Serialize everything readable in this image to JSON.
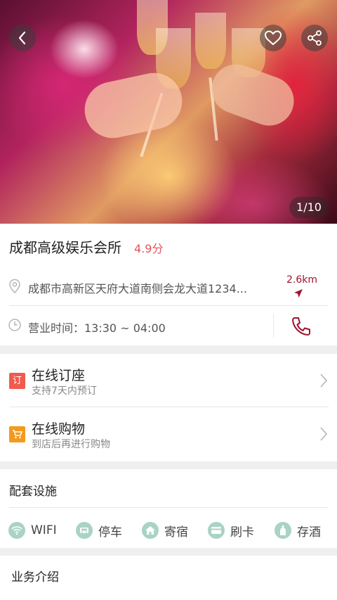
{
  "hero": {
    "pager": "1/10"
  },
  "venue": {
    "name": "成都高级娱乐会所",
    "score": "4.9分",
    "address": "成都市高新区天府大道南侧会龙大道1234...",
    "distance": "2.6km",
    "hours": "营业时间：13:30 ~ 04:00"
  },
  "services": [
    {
      "badge": "订",
      "title": "在线订座",
      "subtitle": "支持7天内预订",
      "color": "#f05a4f"
    },
    {
      "badge": "🛒",
      "title": "在线购物",
      "subtitle": "到店后再进行购物",
      "color": "#f39a1e"
    }
  ],
  "facilities": {
    "title": "配套设施",
    "items": [
      {
        "label": "WIFI",
        "icon": "wifi-icon"
      },
      {
        "label": "停车",
        "icon": "car-icon"
      },
      {
        "label": "寄宿",
        "icon": "home-icon"
      },
      {
        "label": "刷卡",
        "icon": "card-icon"
      },
      {
        "label": "存酒",
        "icon": "wine-icon"
      }
    ]
  },
  "business": {
    "title": "业务介绍"
  },
  "colors": {
    "accent": "#e5525e",
    "distance": "#a0122e",
    "facility_icon": "#a9d3c3"
  }
}
